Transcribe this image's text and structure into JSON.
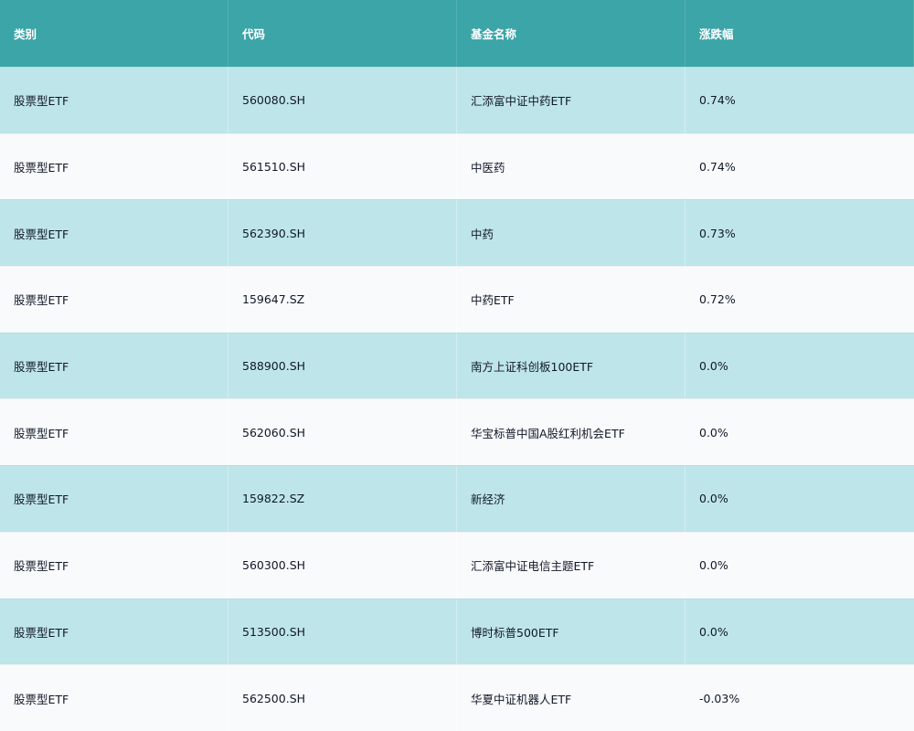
{
  "table": {
    "columns": [
      "类别",
      "代码",
      "基金名称",
      "涨跌幅"
    ],
    "rows": [
      [
        "股票型ETF",
        "560080.SH",
        "汇添富中证中药ETF",
        "0.74%"
      ],
      [
        "股票型ETF",
        "561510.SH",
        "中医药",
        "0.74%"
      ],
      [
        "股票型ETF",
        "562390.SH",
        "中药",
        "0.73%"
      ],
      [
        "股票型ETF",
        "159647.SZ",
        "中药ETF",
        "0.72%"
      ],
      [
        "股票型ETF",
        "588900.SH",
        "南方上证科创板100ETF",
        "0.0%"
      ],
      [
        "股票型ETF",
        "562060.SH",
        "华宝标普中国A股红利机会ETF",
        "0.0%"
      ],
      [
        "股票型ETF",
        "159822.SZ",
        "新经济",
        "0.0%"
      ],
      [
        "股票型ETF",
        "560300.SH",
        "汇添富中证电信主题ETF",
        "0.0%"
      ],
      [
        "股票型ETF",
        "513500.SH",
        "博时标普500ETF",
        "0.0%"
      ],
      [
        "股票型ETF",
        "562500.SH",
        "华夏中证机器人ETF",
        "-0.03%"
      ]
    ]
  },
  "colors": {
    "header_bg": "#3ba5a8",
    "row_odd_bg": "#bee5ea",
    "row_even_bg": "#f8fafc"
  }
}
